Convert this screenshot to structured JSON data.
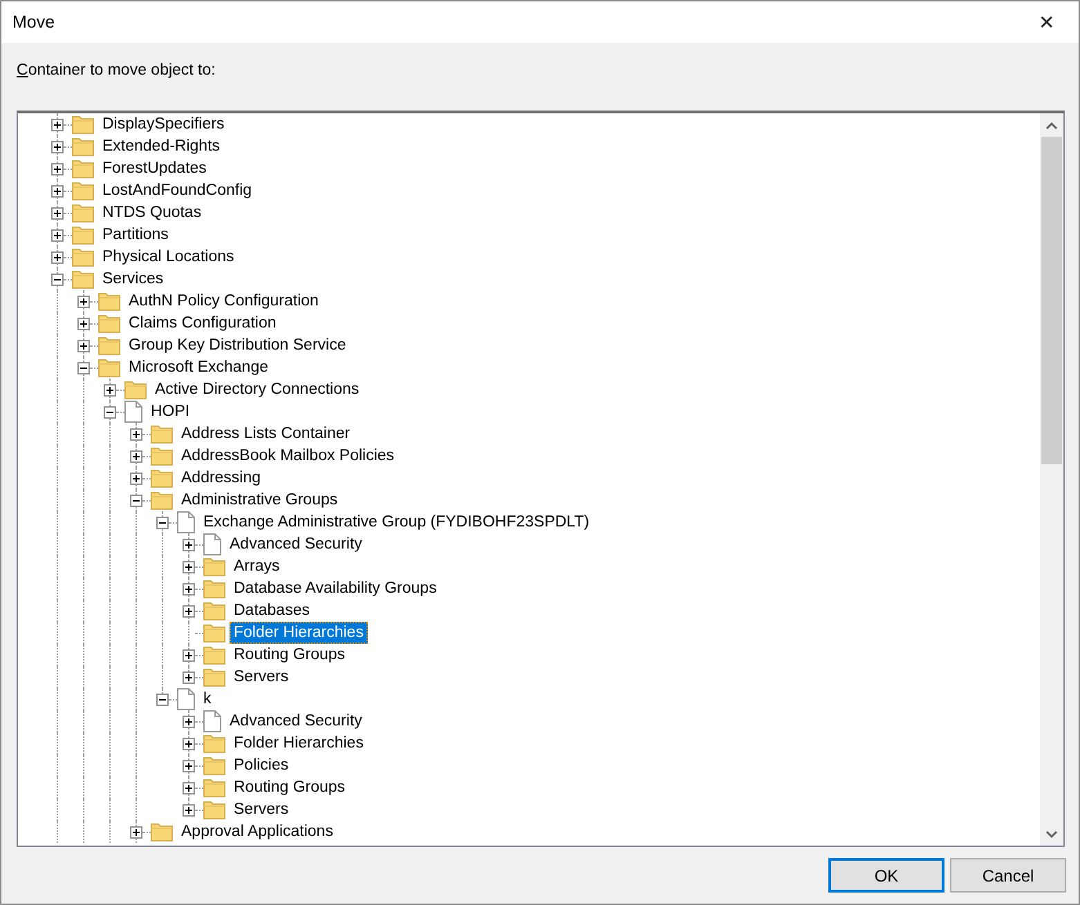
{
  "window": {
    "title": "Move",
    "close": "✕"
  },
  "prompt": "Container to move object to:",
  "tree": [
    {
      "label": "DisplaySpecifiers",
      "kind": "folder",
      "expanded": false,
      "selected": false
    },
    {
      "label": "Extended-Rights",
      "kind": "folder",
      "expanded": false,
      "selected": false
    },
    {
      "label": "ForestUpdates",
      "kind": "folder",
      "expanded": false,
      "selected": false
    },
    {
      "label": "LostAndFoundConfig",
      "kind": "folder",
      "expanded": false,
      "selected": false
    },
    {
      "label": "NTDS Quotas",
      "kind": "folder",
      "expanded": false,
      "selected": false
    },
    {
      "label": "Partitions",
      "kind": "folder",
      "expanded": false,
      "selected": false
    },
    {
      "label": "Physical Locations",
      "kind": "folder",
      "expanded": false,
      "selected": false
    },
    {
      "label": "Services",
      "kind": "folder",
      "expanded": true,
      "selected": false,
      "children": [
        {
          "label": "AuthN Policy Configuration",
          "kind": "folder",
          "expanded": false,
          "selected": false
        },
        {
          "label": "Claims Configuration",
          "kind": "folder",
          "expanded": false,
          "selected": false
        },
        {
          "label": "Group Key Distribution Service",
          "kind": "folder",
          "expanded": false,
          "selected": false
        },
        {
          "label": "Microsoft Exchange",
          "kind": "folder",
          "expanded": true,
          "selected": false,
          "children": [
            {
              "label": "Active Directory Connections",
              "kind": "folder",
              "expanded": false,
              "selected": false
            },
            {
              "label": "HOPI",
              "kind": "document",
              "expanded": true,
              "selected": false,
              "children": [
                {
                  "label": "Address Lists Container",
                  "kind": "folder",
                  "expanded": false,
                  "selected": false
                },
                {
                  "label": "AddressBook Mailbox Policies",
                  "kind": "folder",
                  "expanded": false,
                  "selected": false
                },
                {
                  "label": "Addressing",
                  "kind": "folder",
                  "expanded": false,
                  "selected": false
                },
                {
                  "label": "Administrative Groups",
                  "kind": "folder",
                  "expanded": true,
                  "selected": false,
                  "children": [
                    {
                      "label": "Exchange Administrative Group (FYDIBOHF23SPDLT)",
                      "kind": "document",
                      "expanded": true,
                      "selected": false,
                      "children": [
                        {
                          "label": "Advanced Security",
                          "kind": "document",
                          "expanded": false,
                          "selected": false
                        },
                        {
                          "label": "Arrays",
                          "kind": "folder",
                          "expanded": false,
                          "selected": false
                        },
                        {
                          "label": "Database Availability Groups",
                          "kind": "folder",
                          "expanded": false,
                          "selected": false
                        },
                        {
                          "label": "Databases",
                          "kind": "folder",
                          "expanded": false,
                          "selected": false
                        },
                        {
                          "label": "Folder Hierarchies",
                          "kind": "folder",
                          "selected": true
                        },
                        {
                          "label": "Routing Groups",
                          "kind": "folder",
                          "expanded": false,
                          "selected": false
                        },
                        {
                          "label": "Servers",
                          "kind": "folder",
                          "expanded": false,
                          "selected": false
                        }
                      ]
                    },
                    {
                      "label": "k",
                      "kind": "document",
                      "expanded": true,
                      "selected": false,
                      "children": [
                        {
                          "label": "Advanced Security",
                          "kind": "document",
                          "expanded": false,
                          "selected": false
                        },
                        {
                          "label": "Folder Hierarchies",
                          "kind": "folder",
                          "expanded": false,
                          "selected": false
                        },
                        {
                          "label": "Policies",
                          "kind": "folder",
                          "expanded": false,
                          "selected": false
                        },
                        {
                          "label": "Routing Groups",
                          "kind": "folder",
                          "expanded": false,
                          "selected": false
                        },
                        {
                          "label": "Servers",
                          "kind": "folder",
                          "expanded": false,
                          "selected": false
                        }
                      ]
                    }
                  ]
                },
                {
                  "label": "Approval Applications",
                  "kind": "folder",
                  "expanded": false,
                  "selected": false
                }
              ]
            }
          ]
        }
      ]
    }
  ],
  "buttons": [
    {
      "label": "OK",
      "default": true
    },
    {
      "label": "Cancel",
      "default": false
    }
  ]
}
